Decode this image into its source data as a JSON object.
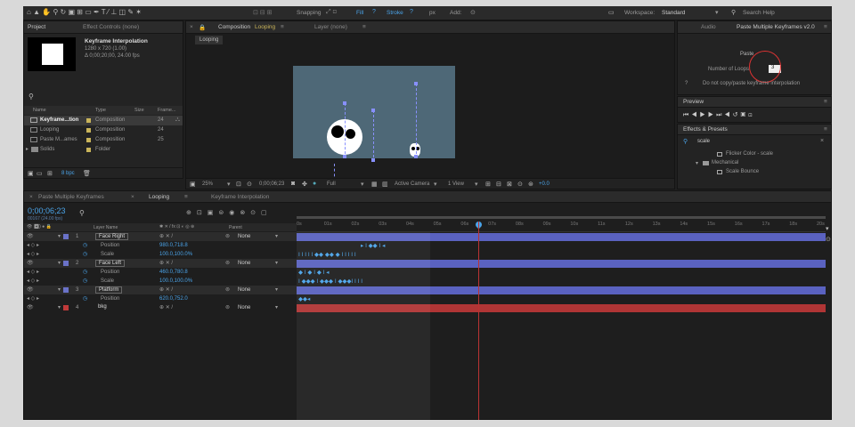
{
  "toolbar": {
    "snapping": "Snapping",
    "fill": "Fill",
    "stroke": "Stroke",
    "px": "px",
    "add": "Add:",
    "workspace_label": "Workspace:",
    "workspace_value": "Standard",
    "search_help": "Search Help"
  },
  "project": {
    "tab": "Project",
    "effect_controls": "Effect Controls (none)",
    "comp_name": "Keyframe Interpolation",
    "comp_info1": "1280 x 720 (1.00)",
    "comp_info2": "Δ 0;00;20;00, 24.00 fps",
    "cols": [
      "Name",
      "Type",
      "Size",
      "Frame..."
    ],
    "items": [
      {
        "name": "Keyframe...tion",
        "type": "Composition",
        "size": "24",
        "color": "#c9b45a"
      },
      {
        "name": "Looping",
        "type": "Composition",
        "size": "24",
        "color": "#c9b45a"
      },
      {
        "name": "Paste M...ames",
        "type": "Composition",
        "size": "25",
        "color": "#c9b45a"
      },
      {
        "name": "Solids",
        "type": "Folder",
        "size": "",
        "color": "#c9b45a"
      }
    ],
    "bpc": "8 bpc"
  },
  "composition": {
    "tab": "Composition",
    "name": "Looping",
    "layer_tab": "Layer (none)",
    "sub_tab": "Looping",
    "zoom": "25%",
    "timecode": "0;00;06;23",
    "quality": "Full",
    "camera": "Active Camera",
    "view": "1 View",
    "exposure": "+0.0"
  },
  "right": {
    "audio_tab": "Audio",
    "script_tab": "Paste Multiple Keyframes v2.0",
    "paste_label": "Paste",
    "loops_label": "Number of Loops:",
    "loops_value": "3",
    "no_copy": "Do not copy/paste keyframe interpolation",
    "help": "?",
    "preview": "Preview",
    "effects": "Effects & Presets",
    "search_value": "scale",
    "fx_items": [
      "Flicker Color - scale",
      "Mechanical",
      "Scale Bounce"
    ]
  },
  "timeline": {
    "tabs": [
      "Paste Multiple Keyframes",
      "Looping",
      "Keyframe Interpolation"
    ],
    "timecode": "0;00;06;23",
    "timecode_sub": "00167 (24.00 fps)",
    "col_layer": "Layer Name",
    "col_parent": "Parent",
    "ticks": [
      "0s",
      "01s",
      "02s",
      "03s",
      "04s",
      "05s",
      "06s",
      "07s",
      "08s",
      "09s",
      "10s",
      "11s",
      "12s",
      "13s",
      "14s",
      "15s",
      "16s",
      "17s",
      "18s",
      "20s"
    ],
    "layers": [
      {
        "num": "1",
        "name": "Face Right",
        "parent": "None",
        "color": "#6a72c8"
      },
      {
        "prop": "Position",
        "value": "980.0,718.8"
      },
      {
        "prop": "Scale",
        "value": "100.0,100.0%"
      },
      {
        "num": "2",
        "name": "Face Left",
        "parent": "None",
        "color": "#6a72c8"
      },
      {
        "prop": "Position",
        "value": "460.0,780.8"
      },
      {
        "prop": "Scale",
        "value": "100.0,100.0%"
      },
      {
        "num": "3",
        "name": "Platform",
        "parent": "None",
        "color": "#6a72c8"
      },
      {
        "prop": "Position",
        "value": "620.0,752.0"
      },
      {
        "num": "4",
        "name": "bkg",
        "parent": "None",
        "color": "#c03a3a"
      }
    ],
    "keyframes": [
      "▸ I ◆◆ I ◂",
      "I I I I I ◆◆ ◆◆ ◆ I I I I I",
      "◆ I ◆ I ◆ I ◂",
      "I ◆◆◆ I ◆◆◆ I ◆◆◆I I I I",
      "◆◆◂"
    ]
  },
  "colors": {
    "accent": "#4aa3e8",
    "bar_blue": "#5a62c0",
    "bar_red": "#b03535",
    "comp_bg": "#4e6877"
  }
}
